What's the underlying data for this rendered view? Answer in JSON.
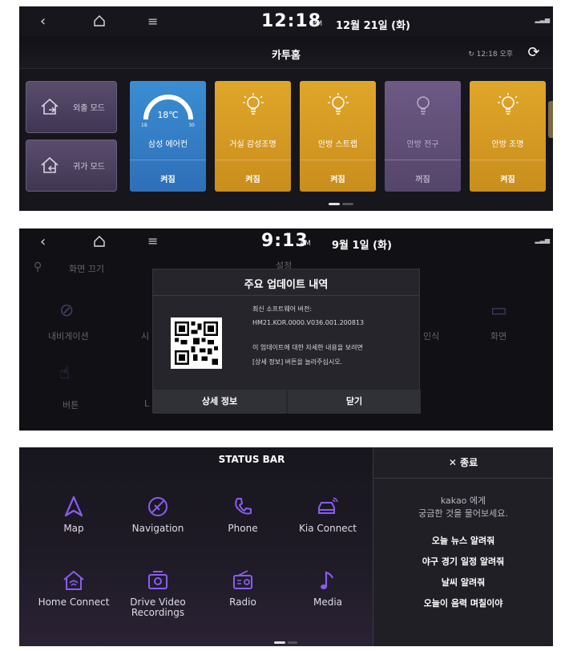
{
  "panel1": {
    "time": "12:18",
    "ampm": "PM",
    "date": "12월 21일 (화)",
    "signal": "⁼⁼ᐧᵢₗ",
    "title": "카투홈",
    "sync_time": "12:18 오후",
    "modes": [
      {
        "label": "외출 모드",
        "icon": "leave-home-icon"
      },
      {
        "label": "귀가 모드",
        "icon": "return-home-icon"
      }
    ],
    "ac": {
      "name": "삼성 에어컨",
      "temp": "18℃",
      "min": "18",
      "max": "30",
      "state": "켜짐"
    },
    "lights": [
      {
        "name": "거실 감성조명",
        "state": "켜짐",
        "on": true
      },
      {
        "name": "안방 스트랩",
        "state": "켜짐",
        "on": true
      },
      {
        "name": "안방 전구",
        "state": "꺼짐",
        "on": false
      },
      {
        "name": "안방 조명",
        "state": "켜짐",
        "on": true
      }
    ],
    "colors": {
      "ac": "#3a8ed2",
      "on": "#e0a62a",
      "off": "#6e5a85",
      "mode": "#5a4d6b"
    }
  },
  "panel2": {
    "time": "9:13",
    "ampm": "AM",
    "date": "9월 1일 (화)",
    "bg_search": "화면 끄기",
    "bg_title": "설정",
    "bg_items": [
      "내비게이션",
      "시",
      "인식",
      "화면",
      "버튼",
      "L"
    ],
    "popup": {
      "title": "주요 업데이트 내역",
      "version_label": "최신 소프트웨어 버전:",
      "version": "HM21.KOR.0000.V036.001.200813",
      "info_line1": "이 업데이트에 대한 자세한 내용을 보려면",
      "info_line2": "[상세 정보] 버튼을 눌러주십시오.",
      "details_button": "상세 정보",
      "close_button": "닫기"
    }
  },
  "panel3": {
    "title": "STATUS BAR",
    "apps": [
      {
        "label": "Map",
        "icon": "map-arrow-icon"
      },
      {
        "label": "Navigation",
        "icon": "navigation-icon"
      },
      {
        "label": "Phone",
        "icon": "phone-icon"
      },
      {
        "label": "Kia Connect",
        "icon": "kia-connect-icon"
      },
      {
        "label": "Home Connect",
        "icon": "home-connect-icon"
      },
      {
        "label": "Drive Video\nRecordings",
        "icon": "camera-icon"
      },
      {
        "label": "Radio",
        "icon": "radio-icon"
      },
      {
        "label": "Media",
        "icon": "music-note-icon"
      }
    ],
    "kakao": {
      "close_label": "✕ 종료",
      "line1": "kakao 에게",
      "line2": "궁금한 것을 물어보세요.",
      "suggestions": [
        "오늘 뉴스 알려줘",
        "야구 경기 일정 알려줘",
        "날씨 알려줘",
        "오늘이 음력 며칠이야"
      ]
    },
    "accent": "#8a5cf0"
  }
}
